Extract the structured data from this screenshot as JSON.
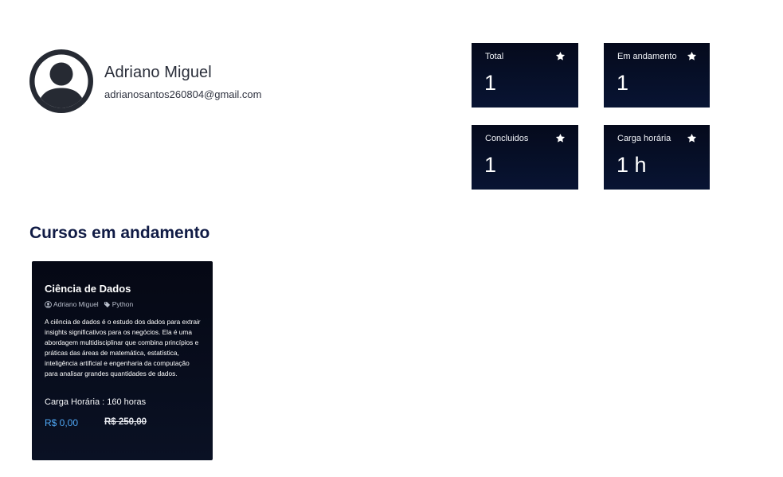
{
  "profile": {
    "name": "Adriano Miguel",
    "email": "adrianosantos260804@gmail.com",
    "avatar_icon": "user-circle-icon"
  },
  "stats": [
    {
      "label": "Total",
      "value": "1",
      "icon": "star-icon"
    },
    {
      "label": "Em andamento",
      "value": "1",
      "icon": "star-icon"
    },
    {
      "label": "Concluidos",
      "value": "1",
      "icon": "star-icon"
    },
    {
      "label": "Carga horária",
      "value": "1 h",
      "icon": "star-icon"
    }
  ],
  "section": {
    "title": "Cursos em andamento"
  },
  "course": {
    "title": "Ciência de Dados",
    "author": "Adriano Miguel",
    "author_icon": "user-circle-icon",
    "tag": "Python",
    "tag_icon": "tag-icon",
    "description": "A ciência de dados é o estudo dos dados para extrair insights significativos para os negócios. Ela é uma abordagem multidisciplinar que combina princípios e práticas das áreas de matemática, estatística, inteligência artificial e engenharia da computação para analisar grandes quantidades de dados.",
    "hours": "Carga Horária : 160 horas",
    "price": "R$ 0,00",
    "old_price": "R$ 250,00"
  },
  "colors": {
    "card_background": "#060b1d",
    "section_title": "#101b45",
    "price_accent": "#4fa8f5"
  }
}
